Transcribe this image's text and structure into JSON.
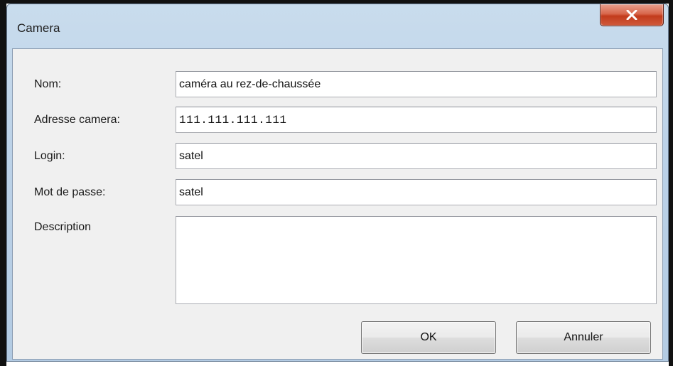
{
  "window": {
    "title": "Camera"
  },
  "form": {
    "fields": [
      {
        "label": "Nom:",
        "value": "caméra au rez-de-chaussée"
      },
      {
        "label": "Adresse camera:",
        "value": "111.111.111.111"
      },
      {
        "label": "Login:",
        "value": "satel"
      },
      {
        "label": "Mot de passe:",
        "value": "satel"
      }
    ],
    "description_label": "Description",
    "description_value": ""
  },
  "buttons": {
    "ok": "OK",
    "cancel": "Annuler"
  },
  "icons": {
    "close": "close-icon"
  },
  "colors": {
    "close_button": "#c7452a",
    "dialog_background": "#f0f0f0",
    "title_bar": "#bcd2e8"
  }
}
